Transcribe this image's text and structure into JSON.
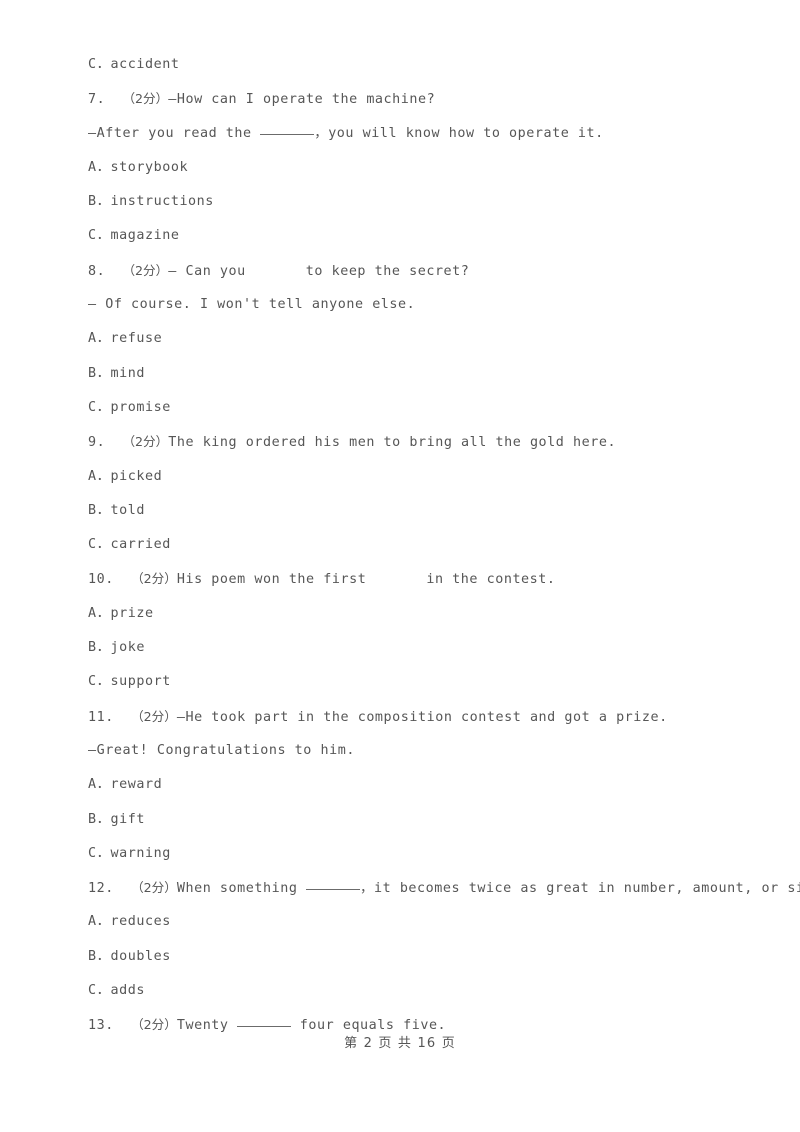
{
  "document": {
    "page_footer": "第 2 页 共 16 页",
    "page_number": "2",
    "total_pages": "16",
    "score_marker": "（2分）"
  },
  "lines": [
    {
      "id": "l1",
      "kind": "option",
      "text": "C．accident"
    },
    {
      "id": "l2",
      "kind": "question",
      "number": "7.",
      "marker": "（2分）",
      "text": "—How can I operate the machine?"
    },
    {
      "id": "l3",
      "kind": "continuation",
      "pre": "—After you read the ",
      "blank": "underline",
      "post": "，you will know how to operate it."
    },
    {
      "id": "l4",
      "kind": "option",
      "text": "A．storybook"
    },
    {
      "id": "l5",
      "kind": "option",
      "text": "B．instructions"
    },
    {
      "id": "l6",
      "kind": "option",
      "text": "C．magazine"
    },
    {
      "id": "l7",
      "kind": "question_blank",
      "number": "8.",
      "marker": "（2分）",
      "pre": "— Can you",
      "blank": "gap",
      "post": "to keep the secret?"
    },
    {
      "id": "l8",
      "kind": "continuation",
      "pre": "— Of course. I won't tell anyone else.",
      "blank": "none",
      "post": ""
    },
    {
      "id": "l9",
      "kind": "option",
      "text": "A．refuse"
    },
    {
      "id": "l10",
      "kind": "option",
      "text": "B．mind"
    },
    {
      "id": "l11",
      "kind": "option",
      "text": "C．promise"
    },
    {
      "id": "l12",
      "kind": "question",
      "number": "9.",
      "marker": "（2分）",
      "text": "The king ordered his men to bring all the gold here."
    },
    {
      "id": "l13",
      "kind": "option",
      "text": "A．picked"
    },
    {
      "id": "l14",
      "kind": "option",
      "text": "B．told"
    },
    {
      "id": "l15",
      "kind": "option",
      "text": "C．carried"
    },
    {
      "id": "l16",
      "kind": "question_blank",
      "number": "10.",
      "marker": "（2分）",
      "pre": "His poem won the first",
      "blank": "gap",
      "post": "in the contest."
    },
    {
      "id": "l17",
      "kind": "option",
      "text": "A．prize"
    },
    {
      "id": "l18",
      "kind": "option",
      "text": "B．joke"
    },
    {
      "id": "l19",
      "kind": "option",
      "text": "C．support"
    },
    {
      "id": "l20",
      "kind": "question",
      "number": "11.",
      "marker": "（2分）",
      "text": "—He took part in the composition contest and got a prize."
    },
    {
      "id": "l21",
      "kind": "continuation",
      "pre": "—Great! Congratulations to him.",
      "blank": "none",
      "post": ""
    },
    {
      "id": "l22",
      "kind": "option",
      "text": "A．reward"
    },
    {
      "id": "l23",
      "kind": "option",
      "text": "B．gift"
    },
    {
      "id": "l24",
      "kind": "option",
      "text": "C．warning"
    },
    {
      "id": "l25",
      "kind": "question_blank",
      "number": "12.",
      "marker": "（2分）",
      "pre": "When something ",
      "blank": "underline",
      "post": "，it becomes twice as great in number, amount, or size."
    },
    {
      "id": "l26",
      "kind": "option",
      "text": "A．reduces"
    },
    {
      "id": "l27",
      "kind": "option",
      "text": "B．doubles"
    },
    {
      "id": "l28",
      "kind": "option",
      "text": "C．adds"
    },
    {
      "id": "l29",
      "kind": "question_blank",
      "number": "13.",
      "marker": "（2分）",
      "pre": "Twenty ",
      "blank": "underline",
      "post": " four equals five."
    }
  ]
}
